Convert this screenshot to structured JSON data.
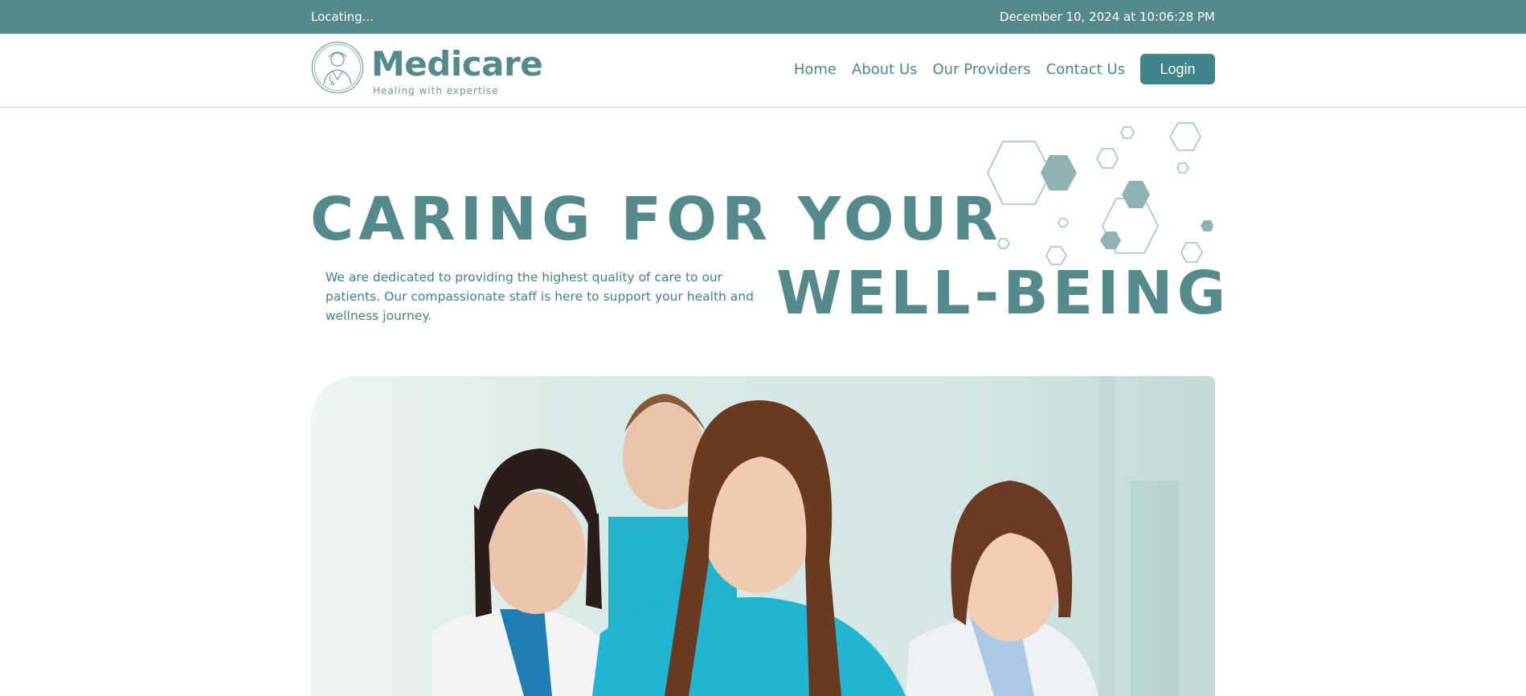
{
  "topbar": {
    "location_text": "Locating...",
    "datetime_text": "December 10, 2024 at 10:06:28 PM"
  },
  "brand": {
    "name": "Medicare",
    "tagline": "Healing with expertise"
  },
  "nav": {
    "items": [
      {
        "label": "Home"
      },
      {
        "label": "About Us"
      },
      {
        "label": "Our Providers"
      },
      {
        "label": "Contact Us"
      }
    ],
    "login_label": "Login"
  },
  "hero": {
    "title_line1": "CARING FOR YOUR",
    "title_line2": "WELL-BEING",
    "description": "We are dedicated to providing the highest quality of care to our patients. Our compassionate staff is here to support your health and wellness journey."
  },
  "colors": {
    "primary": "#548a8b",
    "button": "#3f8488",
    "hex_outline": "#7fb6c8",
    "hex_fill": "#8fb3b5"
  },
  "icons": {
    "logo": "doctor-avatar-icon",
    "decoration": "hexagon-pattern"
  }
}
